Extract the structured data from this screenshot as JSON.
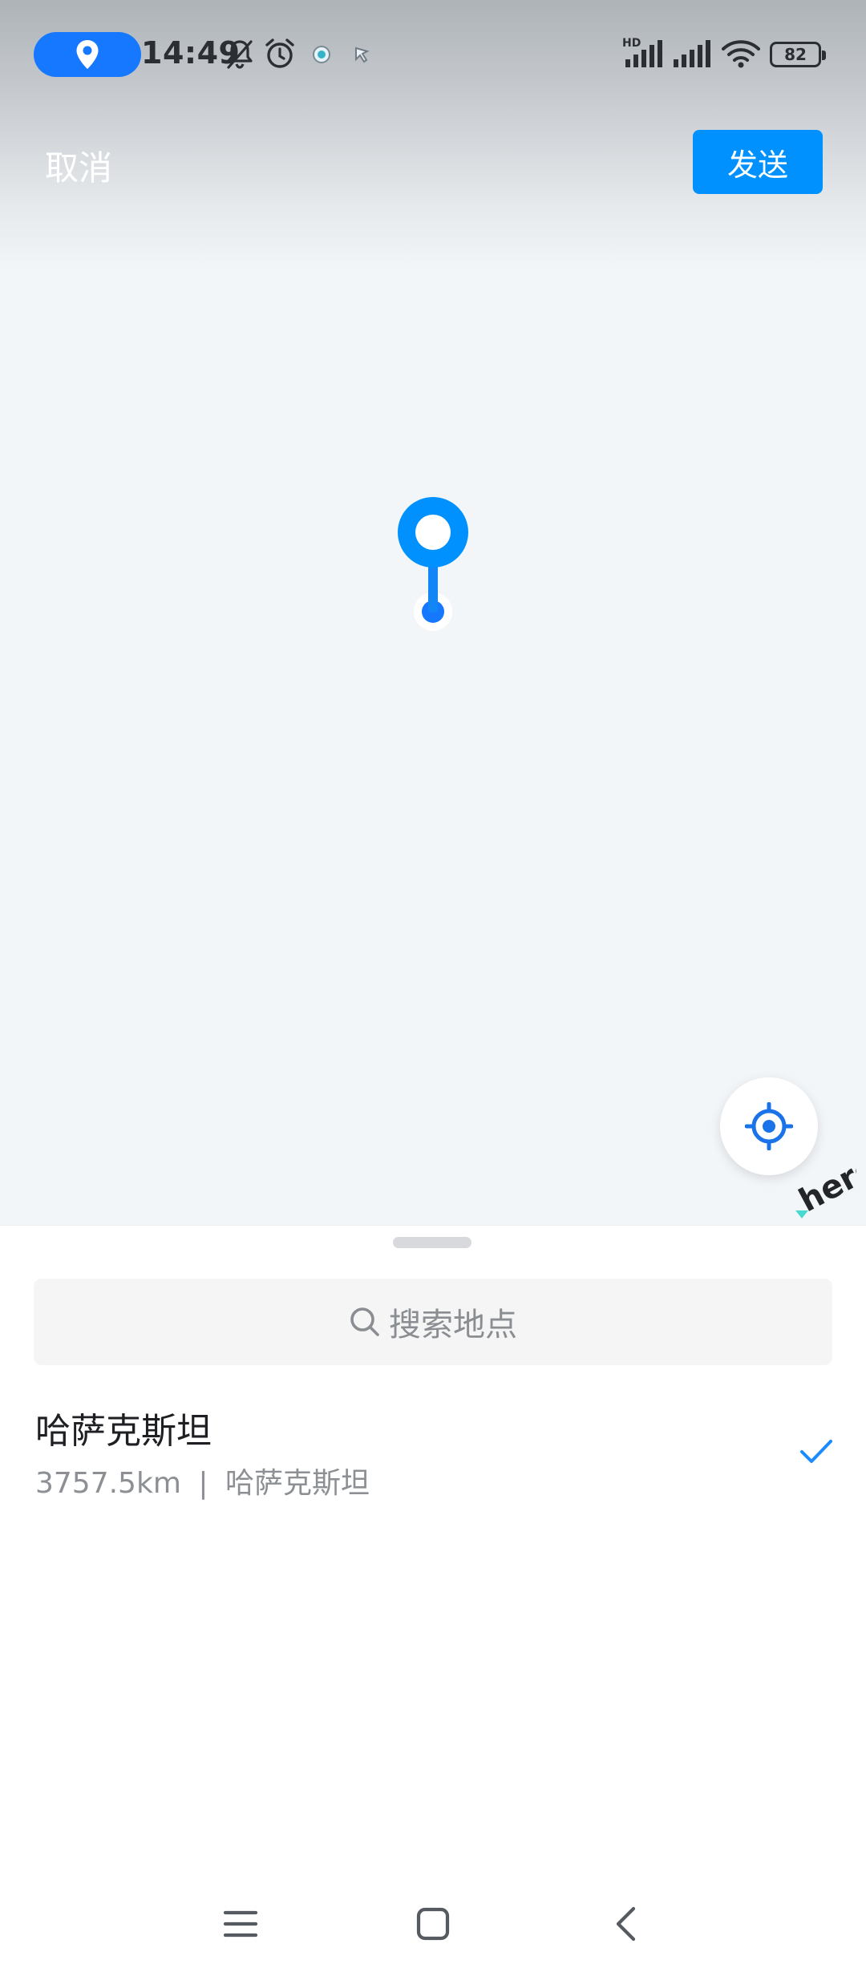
{
  "status_bar": {
    "time": "14:49",
    "battery": "82",
    "network_label": "HD"
  },
  "header": {
    "cancel_label": "取消",
    "send_label": "发送"
  },
  "map": {
    "attribution": "here"
  },
  "search": {
    "placeholder": "搜索地点"
  },
  "place": {
    "name": "哈萨克斯坦",
    "distance": "3757.5km",
    "separator": "|",
    "region": "哈萨克斯坦",
    "selected": true
  },
  "colors": {
    "accent": "#0091ff",
    "status_pill": "#1677ff"
  },
  "icons": {
    "status": [
      "location-pin-icon",
      "mute-bell-icon",
      "alarm-icon",
      "app-notification-icon",
      "app-notification-icon",
      "signal-icon",
      "signal-icon",
      "wifi-icon",
      "battery-icon"
    ],
    "nav": [
      "menu-icon",
      "home-icon",
      "back-icon"
    ]
  }
}
